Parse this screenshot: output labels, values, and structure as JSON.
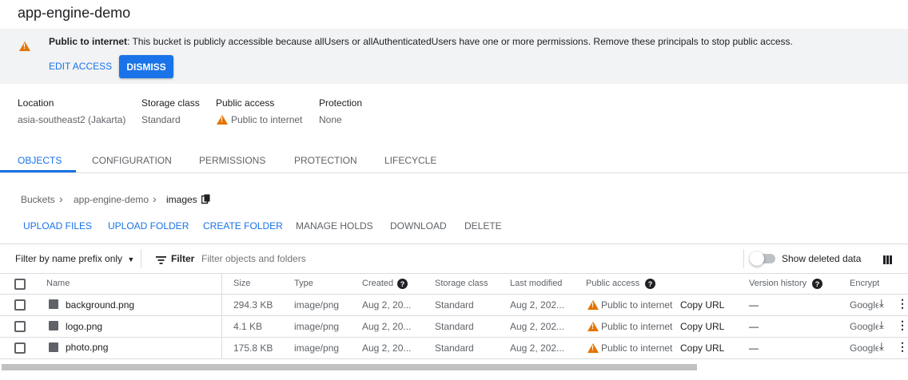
{
  "bucket_title": "app-engine-demo",
  "banner": {
    "heading": "Public to internet",
    "message": ": This bucket is publicly accessible because allUsers or allAuthenticatedUsers have one or more permissions. Remove these principals to stop public access.",
    "edit_access": "EDIT ACCESS",
    "dismiss": "DISMISS"
  },
  "meta": {
    "location_label": "Location",
    "location_value": "asia-southeast2 (Jakarta)",
    "storage_label": "Storage class",
    "storage_value": "Standard",
    "public_label": "Public access",
    "public_value": "Public to internet",
    "protection_label": "Protection",
    "protection_value": "None"
  },
  "tabs": [
    "OBJECTS",
    "CONFIGURATION",
    "PERMISSIONS",
    "PROTECTION",
    "LIFECYCLE"
  ],
  "breadcrumb": [
    "Buckets",
    "app-engine-demo",
    "images"
  ],
  "actions": [
    "UPLOAD FILES",
    "UPLOAD FOLDER",
    "CREATE FOLDER",
    "MANAGE HOLDS",
    "DOWNLOAD",
    "DELETE"
  ],
  "filter": {
    "prefix_select": "Filter by name prefix only",
    "filter_label": "Filter",
    "placeholder": "Filter objects and folders",
    "show_deleted": "Show deleted data"
  },
  "table": {
    "headers": [
      "Name",
      "Size",
      "Type",
      "Created",
      "Storage class",
      "Last modified",
      "Public access",
      "Version history",
      "Encrypt"
    ],
    "rows": [
      {
        "name": "background.png",
        "size": "294.3 KB",
        "type": "image/png",
        "created": "Aug 2, 20...",
        "storage": "Standard",
        "modified": "Aug 2, 202...",
        "public": "Public to internet",
        "copy": "Copy URL",
        "version": "—",
        "encrypt": "Google"
      },
      {
        "name": "logo.png",
        "size": "4.1 KB",
        "type": "image/png",
        "created": "Aug 2, 20...",
        "storage": "Standard",
        "modified": "Aug 2, 202...",
        "public": "Public to internet",
        "copy": "Copy URL",
        "version": "—",
        "encrypt": "Google"
      },
      {
        "name": "photo.png",
        "size": "175.8 KB",
        "type": "image/png",
        "created": "Aug 2, 20...",
        "storage": "Standard",
        "modified": "Aug 2, 202...",
        "public": "Public to internet",
        "copy": "Copy URL",
        "version": "—",
        "encrypt": "Google"
      }
    ]
  },
  "colors": {
    "accent": "#1a73e8",
    "warning": "#e37400"
  }
}
